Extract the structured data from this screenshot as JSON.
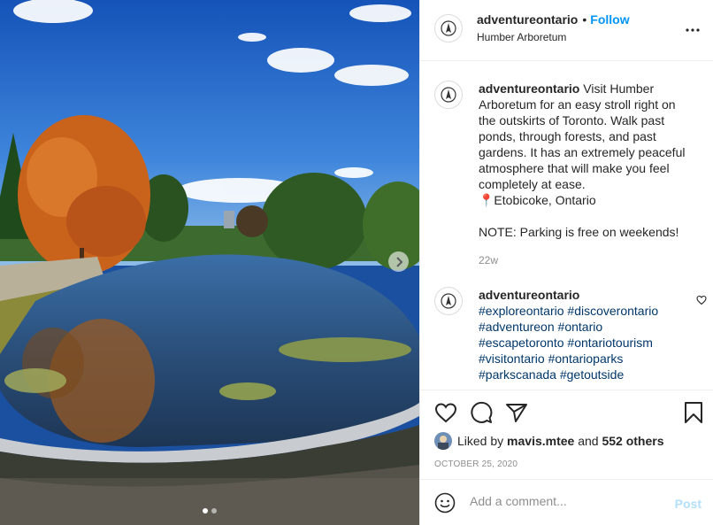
{
  "post": {
    "username": "adventureontario",
    "separator": "•",
    "follow_label": "Follow",
    "location": "Humber Arboretum"
  },
  "caption": {
    "username": "adventureontario",
    "text": "Visit Humber Arboretum for an easy stroll right on the outskirts of Toronto. Walk past ponds, through forests, and past gardens. It has an extremely peaceful atmosphere that will make you feel completely at ease.\n📍Etobicoke, Ontario\n\nNOTE: Parking is free on weekends!",
    "time": "22w"
  },
  "hashtag_comment": {
    "username": "adventureontario",
    "tags": [
      "#exploreontario",
      "#discoverontario",
      "#adventureon",
      "#ontario",
      "#escapetoronto",
      "#ontariotourism",
      "#visitontario",
      "#ontarioparks",
      "#parkscanada",
      "#getoutside"
    ]
  },
  "likes": {
    "prefix": "Liked by",
    "user": "mavis.mtee",
    "middle": "and",
    "others": "552 others"
  },
  "date": "OCTOBER 25, 2020",
  "comment_box": {
    "placeholder": "Add a comment...",
    "post_label": "Post"
  },
  "carousel": {
    "total": 2,
    "active_index": 1
  },
  "icons": {
    "like": "heart-icon",
    "comment": "comment-icon",
    "share": "paper-plane-icon",
    "save": "bookmark-icon",
    "more": "more-options-icon",
    "emoji": "emoji-icon",
    "next": "chevron-right-icon"
  },
  "colors": {
    "link_blue": "#0095f6",
    "hashtag": "#00376b",
    "muted": "#8e8e8e",
    "post_disabled": "#b2dffc"
  }
}
